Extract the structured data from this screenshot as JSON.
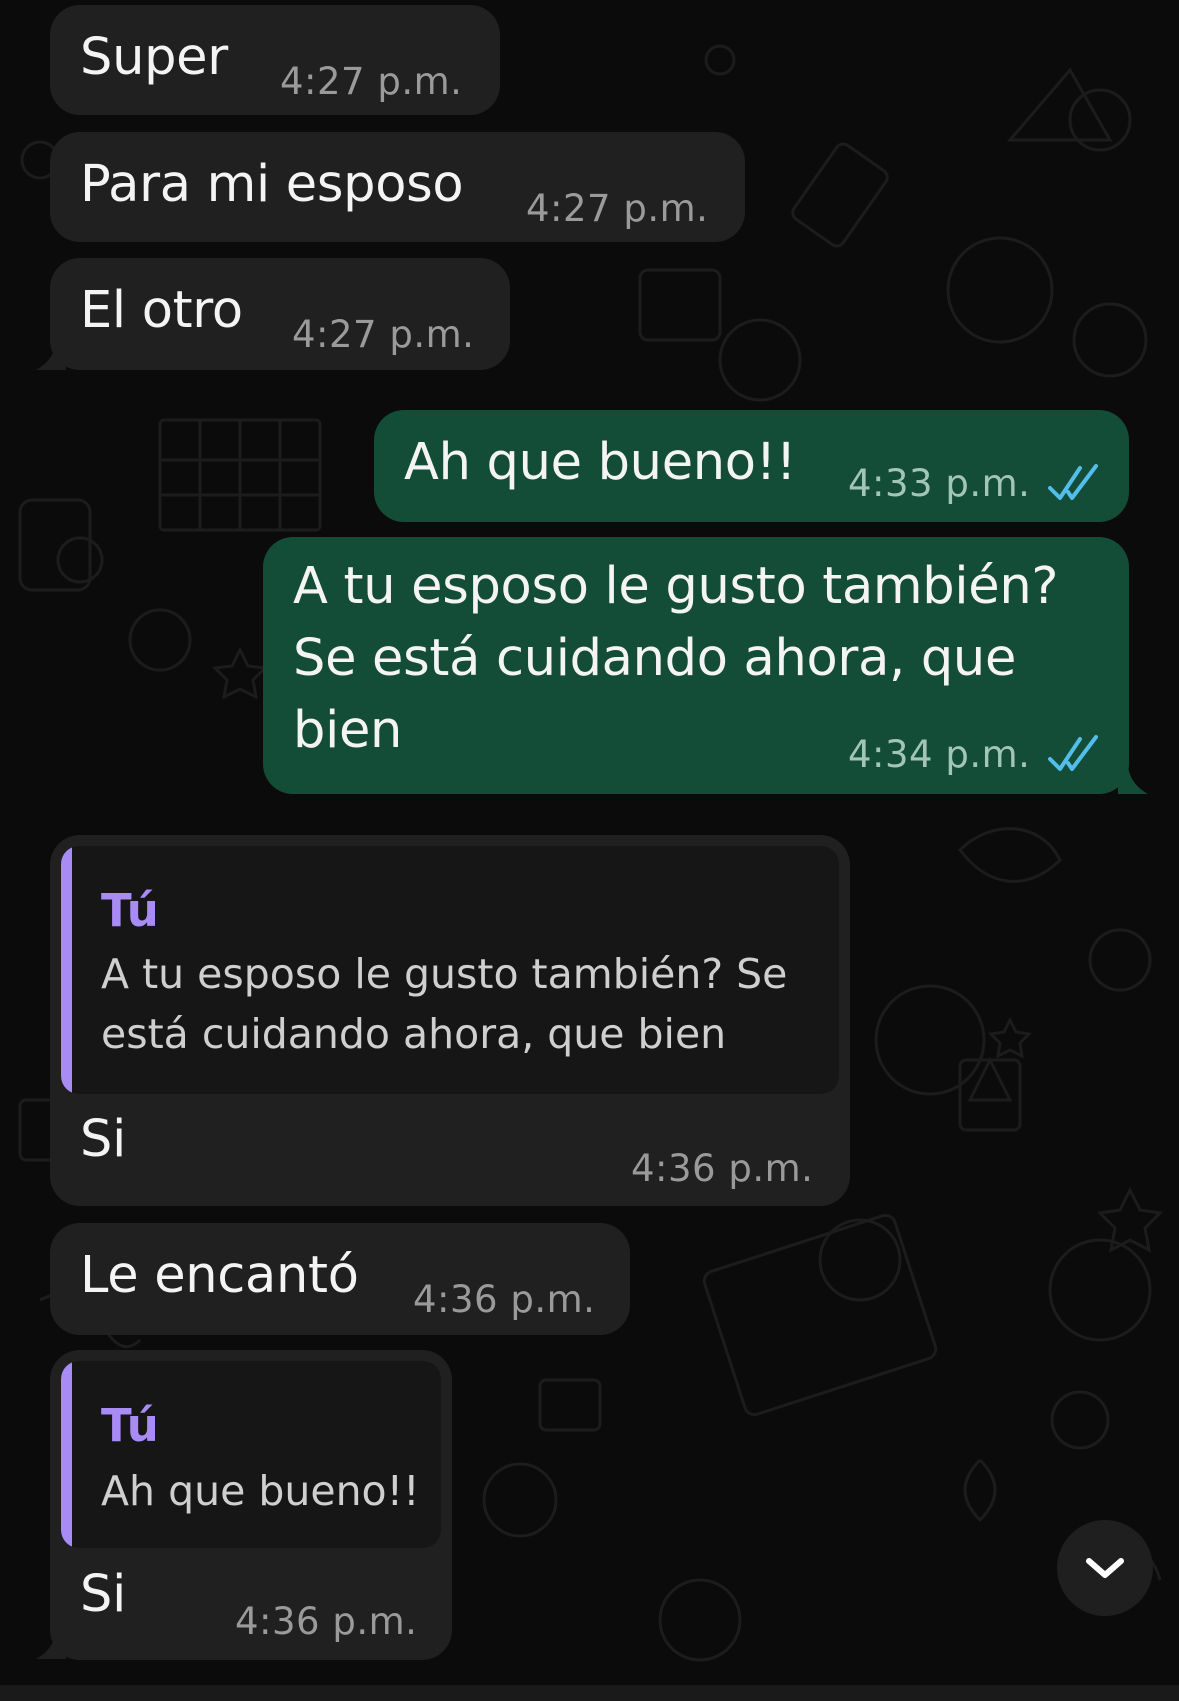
{
  "messages": [
    {
      "direction": "incoming",
      "text": "Super",
      "time": "4:27 p.m."
    },
    {
      "direction": "incoming",
      "text": "Para mi esposo",
      "time": "4:27 p.m."
    },
    {
      "direction": "incoming",
      "text": "El otro",
      "time": "4:27 p.m."
    },
    {
      "direction": "outgoing",
      "text": "Ah que bueno!!",
      "time": "4:33 p.m.",
      "status": "read"
    },
    {
      "direction": "outgoing",
      "lines": [
        "A tu esposo le gusto también?",
        "Se está cuidando ahora, que",
        "bien"
      ],
      "time": "4:34 p.m.",
      "status": "read"
    },
    {
      "direction": "incoming",
      "quote": {
        "author": "Tú",
        "lines": [
          "A tu esposo le gusto también? Se",
          "está cuidando ahora, que bien"
        ]
      },
      "text": "Si",
      "time": "4:36 p.m."
    },
    {
      "direction": "incoming",
      "text": "Le encantó",
      "time": "4:36 p.m."
    },
    {
      "direction": "incoming",
      "quote": {
        "author": "Tú",
        "lines": [
          "Ah que bueno!!"
        ]
      },
      "text": "Si",
      "time": "4:36 p.m."
    }
  ],
  "scroll_button": {
    "icon": "chevron-down-icon"
  },
  "colors": {
    "background": "#0b0b0b",
    "incoming_bubble": "#202020",
    "outgoing_bubble": "#144d37",
    "quote_accent": "#a88bf5",
    "read_ticks": "#53bdeb"
  }
}
